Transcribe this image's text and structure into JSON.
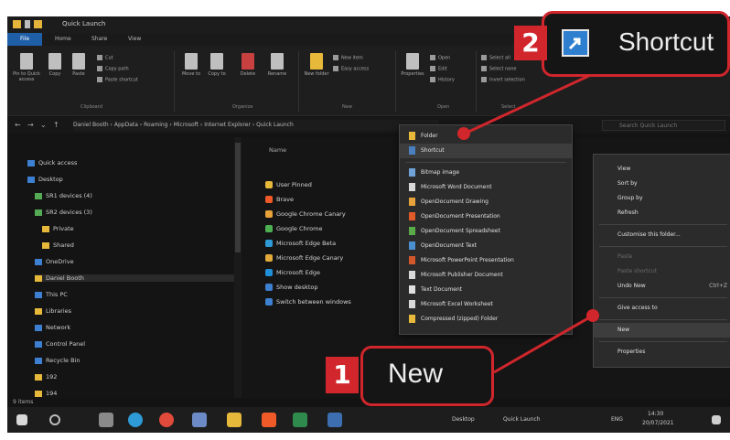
{
  "window": {
    "title": "Quick Launch",
    "tabs": [
      "File",
      "Home",
      "Share",
      "View"
    ]
  },
  "ribbon": {
    "buttons": [
      {
        "label": "Pin to Quick access",
        "icon": "pin-icon"
      },
      {
        "label": "Copy",
        "icon": "copy-icon"
      },
      {
        "label": "Paste",
        "icon": "paste-icon"
      },
      {
        "label": "Move to",
        "icon": "move-icon"
      },
      {
        "label": "Copy to",
        "icon": "copy-to-icon"
      },
      {
        "label": "Delete",
        "icon": "delete-icon"
      },
      {
        "label": "Rename",
        "icon": "rename-icon"
      },
      {
        "label": "New folder",
        "icon": "new-folder-icon"
      },
      {
        "label": "Properties",
        "icon": "properties-icon"
      }
    ],
    "small": [
      "Cut",
      "Copy path",
      "Paste shortcut",
      "New item",
      "Easy access",
      "Open",
      "Edit",
      "History",
      "Select all",
      "Select none",
      "Invert selection"
    ],
    "groups": [
      "Clipboard",
      "Organize",
      "New",
      "Open",
      "Select"
    ]
  },
  "address": {
    "path": "Daniel Booth  ›  AppData  ›  Roaming  ›  Microsoft  ›  Internet Explorer  ›  Quick Launch",
    "search_placeholder": "Search Quick Launch"
  },
  "nav_pane": {
    "items": [
      "Quick access",
      "Desktop",
      "SR1 devices (4)",
      "SR2 devices (3)",
      "Private",
      "Shared",
      "OneDrive",
      "Daniel Booth",
      "This PC",
      "Libraries",
      "Network",
      "Control Panel",
      "Recycle Bin",
      "192",
      "194"
    ]
  },
  "content": {
    "column_header": "Name",
    "files": [
      {
        "name": "User Pinned",
        "color": "#e6b93b"
      },
      {
        "name": "Brave",
        "color": "#f05a28"
      },
      {
        "name": "Google Chrome Canary",
        "color": "#e8a23a"
      },
      {
        "name": "Google Chrome",
        "color": "#4caf50"
      },
      {
        "name": "Microsoft Edge Beta",
        "color": "#2e9ad6"
      },
      {
        "name": "Microsoft Edge Canary",
        "color": "#e2a93b"
      },
      {
        "name": "Microsoft Edge",
        "color": "#1f8fd8"
      },
      {
        "name": "Show desktop",
        "color": "#3d7fd0"
      },
      {
        "name": "Switch between windows",
        "color": "#3d7fd0"
      }
    ]
  },
  "new_submenu": {
    "items": [
      "Folder",
      "Shortcut",
      "Bitmap image",
      "Microsoft Word Document",
      "OpenDocument Drawing",
      "OpenDocument Presentation",
      "OpenDocument Spreadsheet",
      "OpenDocument Text",
      "Microsoft PowerPoint Presentation",
      "Microsoft Publisher Document",
      "Text Document",
      "Microsoft Excel Worksheet",
      "Compressed (zipped) Folder"
    ]
  },
  "context_menu": {
    "view": "View",
    "sort_by": "Sort by",
    "group_by": "Group by",
    "refresh": "Refresh",
    "customise": "Customise this folder...",
    "paste": "Paste",
    "paste_shortcut": "Paste shortcut",
    "undo_new": "Undo New",
    "undo_shortcut": "Ctrl+Z",
    "give_access": "Give access to",
    "new": "New",
    "properties": "Properties"
  },
  "status": {
    "items_count": "9 items"
  },
  "taskbar": {
    "desktop_label": "Desktop",
    "quick_launch_label": "Quick Launch",
    "lang": "ENG",
    "time": "14:30",
    "date": "20/07/2021"
  },
  "callouts": {
    "one": {
      "number": "1",
      "label": "New"
    },
    "two": {
      "number": "2",
      "label": "Shortcut"
    }
  },
  "colors": {
    "accent_red": "#d0262c",
    "file_tab": "#1f5fa8",
    "folder_yellow": "#e6b93b"
  }
}
